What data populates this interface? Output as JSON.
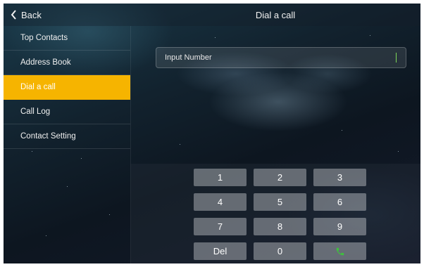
{
  "header": {
    "back_label": "Back",
    "title": "Dial a call"
  },
  "sidebar": {
    "items": [
      {
        "label": "Top Contacts",
        "active": false
      },
      {
        "label": "Address Book",
        "active": false
      },
      {
        "label": "Dial a call",
        "active": true
      },
      {
        "label": "Call Log",
        "active": false
      },
      {
        "label": "Contact Setting",
        "active": false
      }
    ]
  },
  "dial_input": {
    "placeholder": "Input Number",
    "value": ""
  },
  "keypad": {
    "keys": [
      "1",
      "2",
      "3",
      "4",
      "5",
      "6",
      "7",
      "8",
      "9",
      "Del",
      "0"
    ],
    "call_icon": "phone-icon"
  },
  "colors": {
    "accent": "#f6b400",
    "call_green": "#3fbf3f",
    "caret": "#7ed957"
  }
}
